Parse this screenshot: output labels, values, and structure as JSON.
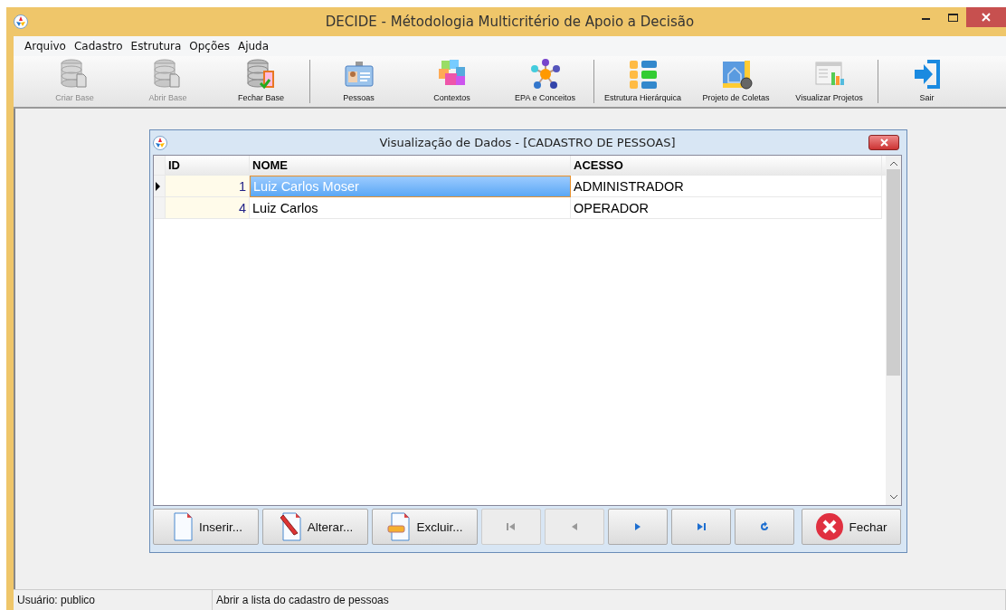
{
  "window": {
    "title": "DECIDE - Métodologia Multicritério de Apoio a Decisão"
  },
  "menu": [
    "Arquivo",
    "Cadastro",
    "Estrutura",
    "Opções",
    "Ajuda"
  ],
  "toolbar": [
    [
      {
        "label": "Criar Base",
        "disabled": true
      },
      {
        "label": "Abrir Base",
        "disabled": true
      },
      {
        "label": "Fechar Base",
        "disabled": false
      }
    ],
    [
      {
        "label": "Pessoas",
        "disabled": false
      },
      {
        "label": "Contextos",
        "disabled": false
      },
      {
        "label": "EPA e Conceitos",
        "disabled": false
      }
    ],
    [
      {
        "label": "Estrutura Hierárquica",
        "disabled": false
      },
      {
        "label": "Projeto de Coletas",
        "disabled": false
      },
      {
        "label": "Visualizar Projetos",
        "disabled": false
      }
    ],
    [
      {
        "label": "Sair",
        "disabled": false
      }
    ]
  ],
  "dialog": {
    "title": "Visualização de Dados - [CADASTRO DE PESSOAS]",
    "table": {
      "columns": [
        "ID",
        "NOME",
        "ACESSO"
      ],
      "rows": [
        {
          "selected": true,
          "cells": [
            "1",
            "Luiz Carlos Moser",
            "ADMINISTRADOR"
          ]
        },
        {
          "selected": false,
          "cells": [
            "4",
            "Luiz Carlos",
            "OPERADOR"
          ]
        }
      ]
    },
    "buttons": [
      {
        "kind": "insert",
        "label": "Inserir..."
      },
      {
        "kind": "edit",
        "label": "Alterar..."
      },
      {
        "kind": "delete",
        "label": "Excluir..."
      },
      {
        "kind": "first",
        "disabled": true
      },
      {
        "kind": "prev",
        "disabled": true
      },
      {
        "kind": "next",
        "disabled": false
      },
      {
        "kind": "last",
        "disabled": false
      },
      {
        "kind": "refresh",
        "disabled": false
      },
      {
        "kind": "close",
        "label": "Fechar"
      }
    ]
  },
  "status_bar": [
    "Usuário: publico",
    "Abrir a lista do cadastro de pessoas"
  ]
}
